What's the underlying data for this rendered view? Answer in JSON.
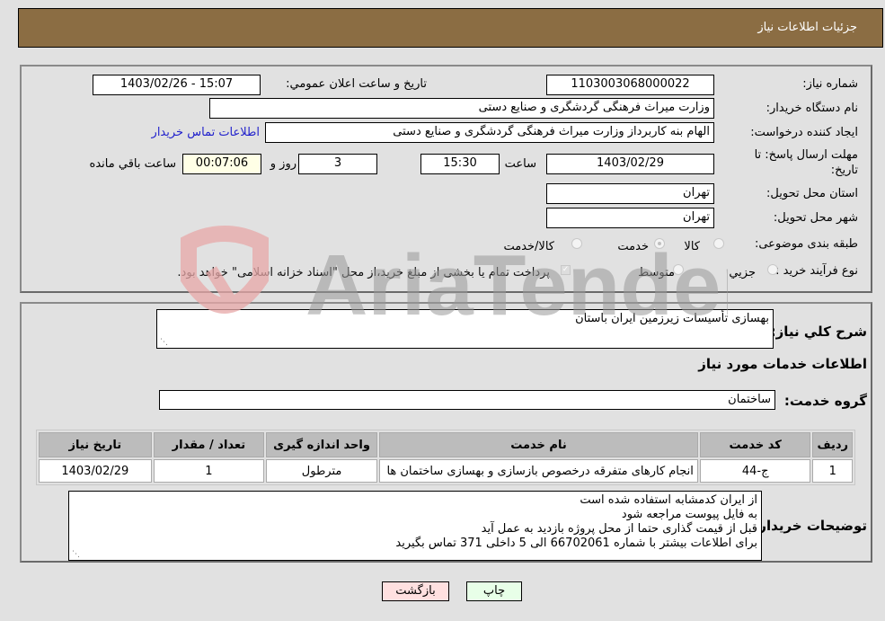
{
  "header": {
    "title": "جزئیات اطلاعات نیاز"
  },
  "form": {
    "need_number": {
      "label": "شماره نیاز:",
      "value": "1103003068000022"
    },
    "announce_datetime": {
      "label": "تاریخ و ساعت اعلان عمومي:",
      "value": "1403/02/26 - 15:07"
    },
    "buyer_org": {
      "label": "نام دستگاه خریدار:",
      "value": "وزارت میراث فرهنگی  گردشگری و صنایع دستی"
    },
    "requester": {
      "label": "ایجاد کننده درخواست:",
      "value": "الهام بنه کاربرداز وزارت میراث فرهنگی  گردشگری و صنایع دستی"
    },
    "buyer_contact_link": "اطلاعات تماس خریدار",
    "deadline": {
      "label_line1": "مهلت ارسال پاسخ: تا",
      "label_line2": "تاریخ:",
      "date": "1403/02/29",
      "time_label": "ساعت",
      "time": "15:30",
      "days": "3",
      "days_label": "روز و",
      "remaining": "00:07:06",
      "remaining_label": "ساعت باقي مانده"
    },
    "province": {
      "label": "استان محل تحویل:",
      "value": "تهران"
    },
    "city": {
      "label": "شهر محل تحویل:",
      "value": "تهران"
    },
    "category": {
      "label": "طبقه بندی موضوعی:",
      "options": [
        "کالا",
        "خدمت",
        "کالا/خدمت"
      ],
      "selected": "خدمت"
    },
    "purchase_type": {
      "label": "نوع فرآیند خرید :",
      "options": [
        "جزيي",
        "متوسط"
      ],
      "note": "پرداخت تمام یا بخشی از مبلغ خرید،از محل \"اسناد خزانه اسلامی\" خواهد بود.",
      "note_checked": true
    }
  },
  "details": {
    "general_desc": {
      "label": "شرح کلي نیاز:",
      "value": "بهسازی تأسیسات زیرزمین ایران باستان"
    },
    "services_title": "اطلاعات خدمات مورد نیاز",
    "service_group": {
      "label": "گروه خدمت:",
      "value": "ساختمان"
    },
    "table": {
      "headers": [
        "ردیف",
        "کد خدمت",
        "نام خدمت",
        "واحد اندازه گیری",
        "تعداد / مقدار",
        "تاریخ نیاز"
      ],
      "rows": [
        [
          "1",
          "ج-44",
          "انجام کارهای متفرقه درخصوص بازسازی و بهسازی ساختمان ها",
          "مترطول",
          "1",
          "1403/02/29"
        ]
      ]
    },
    "buyer_notes": {
      "label": "توضیحات خریدار:",
      "lines": [
        "از ایران کدمشابه استفاده شده است",
        "به فایل پیوست مراجعه شود",
        "قبل از قیمت گذاری حتما از محل پروژه بازدید به عمل آید",
        "برای اطلاعات بیشتر با شماره 66702061 الی 5 داخلی 371 تماس بگیرید"
      ]
    }
  },
  "buttons": {
    "back": "بازگشت",
    "print": "چاپ"
  },
  "watermark": {
    "text": "AriaTender.neT"
  }
}
